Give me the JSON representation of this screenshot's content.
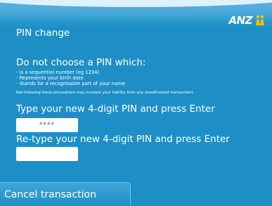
{
  "brand": {
    "logo_text": "ANZ",
    "logo_icon": "anz-people-icon"
  },
  "screen": {
    "title": "PIN change"
  },
  "warning": {
    "heading": "Do not choose a PIN which:",
    "items": [
      "- Is a sequential number (eg 1234)",
      "- Represents your birth date",
      "- Stands for a recognisable part of your name"
    ],
    "footnote": "Not following these precautions may increase your liability from any unauthorised transactions"
  },
  "pin_entry": {
    "prompt": "Type your new 4-digit PIN and press Enter",
    "value": "****"
  },
  "pin_confirm": {
    "prompt": "Re-type your new 4-digit PIN and press Enter",
    "value": ""
  },
  "actions": {
    "cancel_label": "Cancel transaction"
  },
  "colors": {
    "background": "#1e8fc6",
    "accent": "#ffffff"
  }
}
